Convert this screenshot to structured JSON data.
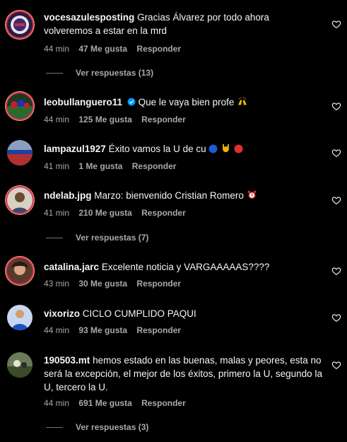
{
  "comments": [
    {
      "user": "vocesazulesposting",
      "text": "Gracias Álvarez por todo ahora volveremos a estar en la mrd",
      "time": "44 min",
      "likes": "47 Me gusta",
      "reply": "Responder",
      "view_replies": "Ver respuestas (13)"
    },
    {
      "user": "leobullanguero11",
      "text": "Que le vaya bien profe",
      "time": "44 min",
      "likes": "125 Me gusta",
      "reply": "Responder"
    },
    {
      "user": "lampazul1927",
      "text": "Éxito vamos la U de cu",
      "time": "41 min",
      "likes": "1 Me gusta",
      "reply": "Responder"
    },
    {
      "user": "ndelab.jpg",
      "text": "Marzo: bienvenido Cristian Romero",
      "time": "41 min",
      "likes": "210 Me gusta",
      "reply": "Responder",
      "view_replies": "Ver respuestas (7)"
    },
    {
      "user": "catalina.jarc",
      "text": "Excelente noticia y VARGAAAAAS????",
      "time": "43 min",
      "likes": "30 Me gusta",
      "reply": "Responder"
    },
    {
      "user": "vixorizo",
      "text": "CICLO CUMPLIDO PAQUI",
      "time": "44 min",
      "likes": "93 Me gusta",
      "reply": "Responder"
    },
    {
      "user": "190503.mt",
      "text": "hemos estado en las buenas, malas y peores, esta no será la excepción, el mejor de los éxitos, primero la U, segundo la U, tercero la U.",
      "time": "44 min",
      "likes": "691 Me gusta",
      "reply": "Responder",
      "view_replies": "Ver respuestas (3)"
    }
  ],
  "colors": {
    "background": "#000000",
    "text": "#f5f5f5",
    "muted": "#a8a8a8",
    "verified": "#0095f6"
  },
  "icons": [
    "heart-icon",
    "verified-badge-icon",
    "raised-hands-emoji",
    "blue-circle-emoji",
    "horns-emoji",
    "red-circle-emoji",
    "alarm-clock-emoji"
  ]
}
